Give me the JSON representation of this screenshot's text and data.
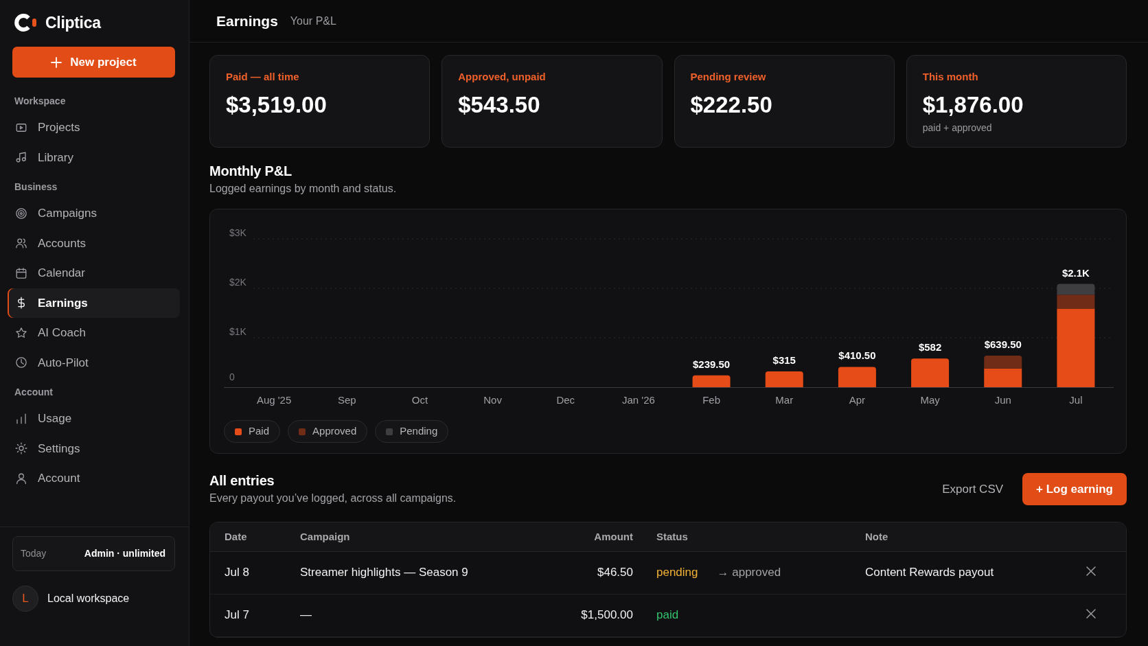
{
  "brand": {
    "name": "Cliptica"
  },
  "new_project_button": {
    "label": "New project"
  },
  "sidebar": {
    "sections": [
      {
        "title": "Workspace",
        "items": [
          {
            "label": "Projects",
            "selected": false
          },
          {
            "label": "Library",
            "selected": false
          }
        ]
      },
      {
        "title": "Business",
        "items": [
          {
            "label": "Campaigns",
            "selected": false
          },
          {
            "label": "Accounts",
            "selected": false
          },
          {
            "label": "Calendar",
            "selected": false
          },
          {
            "label": "Earnings",
            "selected": true
          },
          {
            "label": "AI Coach",
            "selected": false
          },
          {
            "label": "Auto-Pilot",
            "selected": false
          }
        ]
      },
      {
        "title": "Account",
        "items": [
          {
            "label": "Usage",
            "selected": false
          },
          {
            "label": "Settings",
            "selected": false
          },
          {
            "label": "Account",
            "selected": false
          }
        ]
      }
    ]
  },
  "plan_card": {
    "label": "Today",
    "value": "Admin · unlimited"
  },
  "workspace": {
    "avatar_initial": "L",
    "name": "Local workspace"
  },
  "header": {
    "title": "Earnings",
    "subtitle": "Your P&L"
  },
  "stats": [
    {
      "label": "Paid — all time",
      "value": "$3,519.00"
    },
    {
      "label": "Approved, unpaid",
      "value": "$543.50"
    },
    {
      "label": "Pending review",
      "value": "$222.50"
    },
    {
      "label": "This month",
      "value": "$1,876.00",
      "note": "paid + approved"
    }
  ],
  "monthly_pl": {
    "title": "Monthly P&L",
    "subtitle": "Logged earnings by month and status.",
    "chart_data": {
      "type": "bar",
      "stacked": true,
      "categories": [
        "Aug '25",
        "Sep",
        "Oct",
        "Nov",
        "Dec",
        "Jan '26",
        "Feb",
        "Mar",
        "Apr",
        "May",
        "Jun",
        "Jul"
      ],
      "series": [
        {
          "name": "Paid",
          "color": "#e64c17",
          "values": [
            0,
            0,
            0,
            0,
            0,
            0,
            240,
            320,
            410,
            580,
            380,
            1590
          ]
        },
        {
          "name": "Approved",
          "color": "#702c17",
          "values": [
            0,
            0,
            0,
            0,
            0,
            0,
            0,
            0,
            0,
            0,
            260,
            280
          ]
        },
        {
          "name": "Pending",
          "color": "#3e3e41",
          "values": [
            0,
            0,
            0,
            0,
            0,
            0,
            0,
            0,
            0,
            0,
            0,
            220
          ]
        }
      ],
      "ylim": [
        0,
        3000
      ],
      "yticks": [
        {
          "value": 0,
          "label": "0"
        },
        {
          "value": 1000,
          "label": "$1K"
        },
        {
          "value": 2000,
          "label": "$2K"
        },
        {
          "value": 3000,
          "label": "$3K"
        }
      ],
      "value_labels": [
        null,
        null,
        null,
        null,
        null,
        null,
        "$239.50",
        "$315",
        "$410.50",
        "$582",
        "$639.50",
        "$2.1K"
      ]
    }
  },
  "entries": {
    "title": "All entries",
    "subtitle": "Every payout you’ve logged, across all campaigns.",
    "export_button": "Export CSV",
    "log_button": "+ Log earning",
    "table": {
      "columns": [
        "Date",
        "Campaign",
        "Amount",
        "Status",
        "Note"
      ],
      "rows": [
        {
          "date": "Jul 8",
          "campaign": "Streamer highlights — Season 9",
          "amount": "$46.50",
          "status": {
            "label": "pending",
            "color": "#f2b134"
          },
          "advance": "→ approved",
          "note": "Content Rewards payout"
        },
        {
          "date": "Jul 7",
          "campaign": "—",
          "amount": "$1,500.00",
          "status": {
            "label": "paid",
            "color": "#33c46e"
          }
        }
      ]
    }
  }
}
